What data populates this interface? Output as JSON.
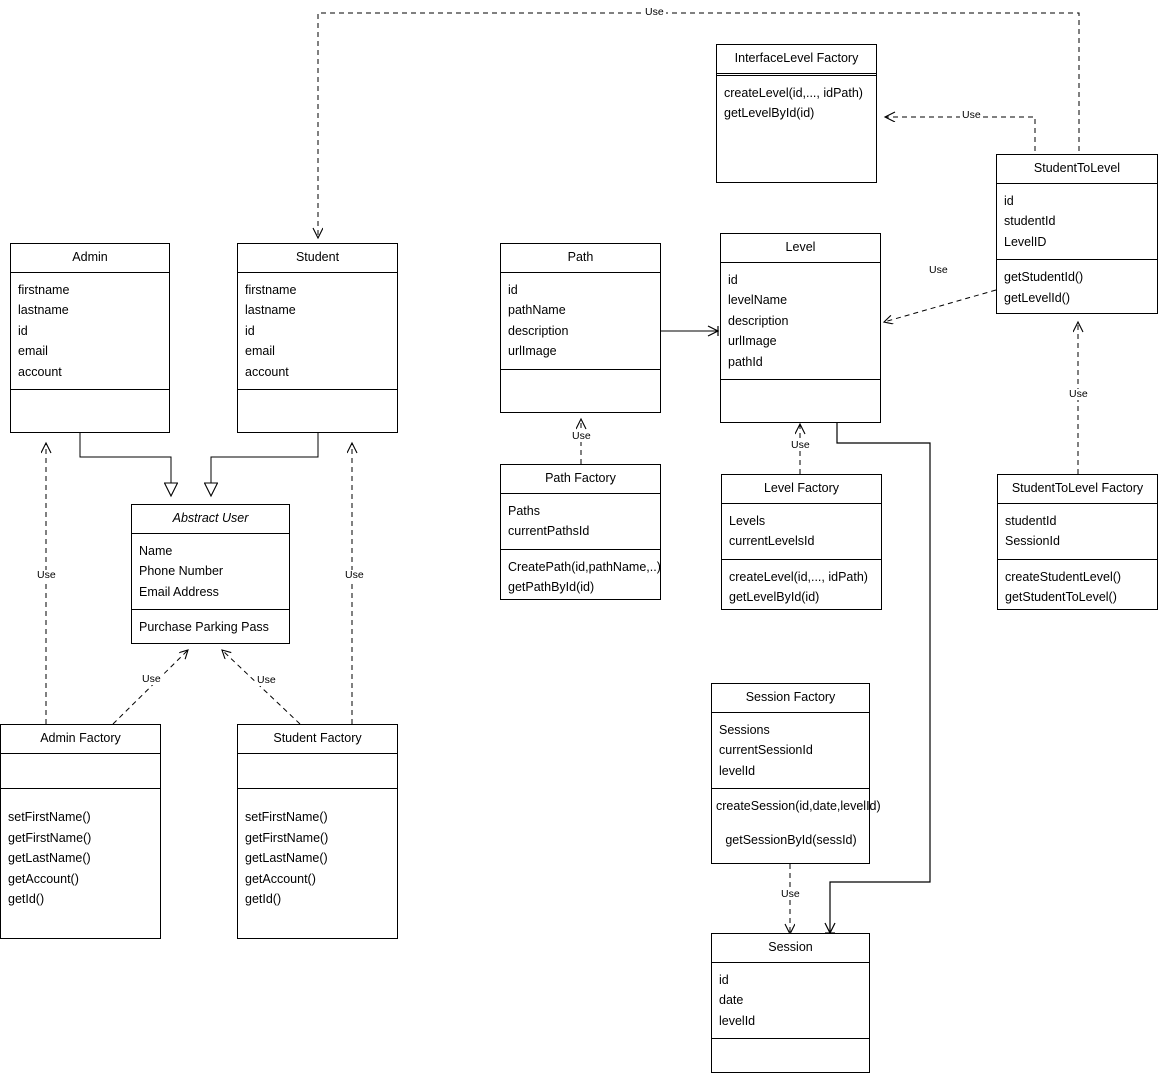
{
  "diagram": {
    "title": "UML Class Diagram",
    "stroke_color": "#000000",
    "background_color": "#ffffff"
  },
  "classes": [
    {
      "id": "interfacelevel-factory",
      "name": "InterfaceLevel Factory",
      "attributes": [],
      "methods": [
        "createLevel(id,..., idPath)",
        "getLevelById(id)"
      ]
    },
    {
      "id": "studenttolevel",
      "name": "StudentToLevel",
      "attributes": [
        "id",
        "studentId",
        "LevelID"
      ],
      "methods": [
        "getStudentId()",
        "getLevelId()"
      ]
    },
    {
      "id": "admin",
      "name": "Admin",
      "attributes": [
        "firstname",
        "lastname",
        "id",
        "email",
        "account"
      ],
      "methods": []
    },
    {
      "id": "student",
      "name": "Student",
      "attributes": [
        "firstname",
        "lastname",
        "id",
        "email",
        "account"
      ],
      "methods": []
    },
    {
      "id": "path",
      "name": "Path",
      "attributes": [
        "id",
        "pathName",
        "description",
        "urlImage"
      ],
      "methods": []
    },
    {
      "id": "level",
      "name": "Level",
      "attributes": [
        "id",
        "levelName",
        "description",
        "urlImage",
        "pathId"
      ],
      "methods": []
    },
    {
      "id": "abstract-user",
      "name": "Abstract User",
      "attributes": [
        "Name",
        "Phone Number",
        "Email Address"
      ],
      "methods": [
        "Purchase Parking Pass"
      ]
    },
    {
      "id": "path-factory",
      "name": "Path Factory",
      "attributes": [
        "Paths",
        "currentPathsId"
      ],
      "methods": [
        "CreatePath(id,pathName,..)",
        "getPathById(id)"
      ]
    },
    {
      "id": "level-factory",
      "name": "Level Factory",
      "attributes": [
        "Levels",
        "currentLevelsId"
      ],
      "methods": [
        "createLevel(id,..., idPath)",
        "getLevelById(id)"
      ]
    },
    {
      "id": "studenttolevel-factory",
      "name": "StudentToLevel Factory",
      "attributes": [
        "studentId",
        "SessionId"
      ],
      "methods": [
        "createStudentLevel()",
        "getStudentToLevel()"
      ]
    },
    {
      "id": "admin-factory",
      "name": "Admin Factory",
      "attributes": [],
      "methods": [
        "setFirstName()",
        "getFirstName()",
        "getLastName()",
        "getAccount()",
        "getId()"
      ]
    },
    {
      "id": "student-factory",
      "name": "Student Factory",
      "attributes": [],
      "methods": [
        "setFirstName()",
        "getFirstName()",
        "getLastName()",
        "getAccount()",
        "getId()"
      ]
    },
    {
      "id": "session-factory",
      "name": "Session Factory",
      "attributes": [
        "Sessions",
        "currentSessionId",
        "levelId"
      ],
      "methods": [
        "createSession(id,date,levelId)",
        "getSessionById(sessId)"
      ]
    },
    {
      "id": "session",
      "name": "Session",
      "attributes": [
        "id",
        "date",
        "levelId"
      ],
      "methods": []
    }
  ],
  "relationships": [
    {
      "id": "studenttolevel-to-student",
      "label": "Use",
      "from": "studenttolevel",
      "to": "student",
      "type": "dependency"
    },
    {
      "id": "studenttolevel-to-interfacelevel-factory",
      "label": "Use",
      "from": "studenttolevel",
      "to": "interfacelevel-factory",
      "type": "dependency"
    },
    {
      "id": "studenttolevel-to-level",
      "label": "Use",
      "from": "studenttolevel",
      "to": "level",
      "type": "dependency"
    },
    {
      "id": "studenttolevel-factory-to-studenttolevel",
      "label": "Use",
      "from": "studenttolevel-factory",
      "to": "studenttolevel",
      "type": "dependency"
    },
    {
      "id": "path-factory-to-path",
      "label": "Use",
      "from": "path-factory",
      "to": "path",
      "type": "dependency"
    },
    {
      "id": "level-factory-to-level",
      "label": "Use",
      "from": "level-factory",
      "to": "level",
      "type": "dependency"
    },
    {
      "id": "session-factory-to-session",
      "label": "Use",
      "from": "session-factory",
      "to": "session",
      "type": "dependency"
    },
    {
      "id": "admin-factory-to-admin",
      "label": "Use",
      "from": "admin-factory",
      "to": "admin",
      "type": "dependency"
    },
    {
      "id": "student-factory-to-student",
      "label": "Use",
      "from": "student-factory",
      "to": "student",
      "type": "dependency"
    },
    {
      "id": "admin-factory-to-abstract-user",
      "label": "Use",
      "from": "admin-factory",
      "to": "abstract-user",
      "type": "dependency"
    },
    {
      "id": "student-factory-to-abstract-user",
      "label": "Use",
      "from": "student-factory",
      "to": "abstract-user",
      "type": "dependency"
    },
    {
      "id": "admin-generalization",
      "label": "",
      "from": "admin",
      "to": "abstract-user",
      "type": "generalization"
    },
    {
      "id": "student-generalization",
      "label": "",
      "from": "student",
      "to": "abstract-user",
      "type": "generalization"
    },
    {
      "id": "path-to-level",
      "label": "",
      "from": "path",
      "to": "level",
      "type": "association"
    },
    {
      "id": "level-to-session",
      "label": "",
      "from": "level",
      "to": "session",
      "type": "association"
    }
  ],
  "edge_labels": {
    "top_use": "Use",
    "interfacelevel_use": "Use",
    "level_use_diag": "Use",
    "studenttolevel_factory_use": "Use",
    "path_factory_use": "Use",
    "level_factory_use": "Use",
    "session_factory_use": "Use",
    "admin_factory_use": "Use",
    "student_factory_use": "Use",
    "admin_factory_abstract_use": "Use",
    "student_factory_abstract_use": "Use"
  }
}
